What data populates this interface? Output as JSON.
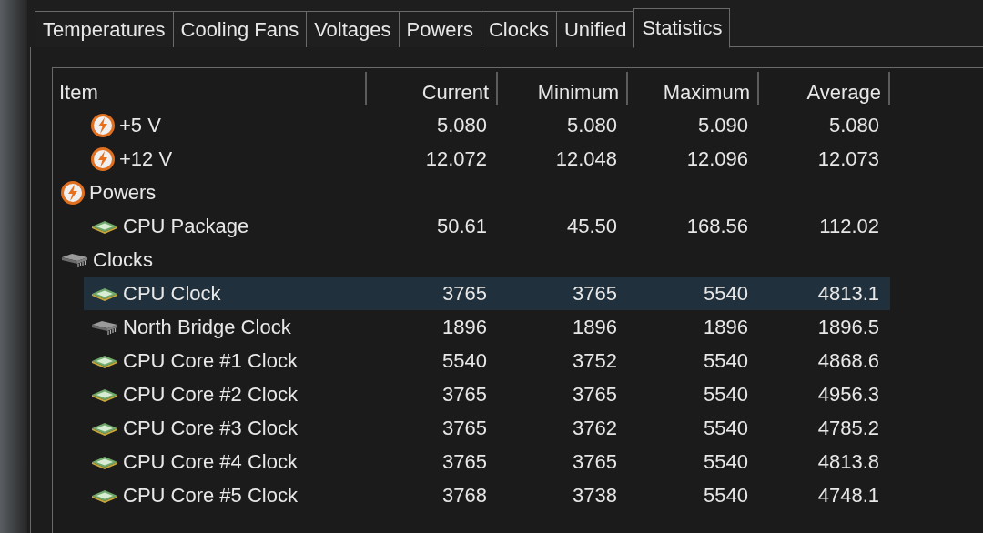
{
  "tabs": [
    {
      "label": "Temperatures",
      "selected": false
    },
    {
      "label": "Cooling Fans",
      "selected": false
    },
    {
      "label": "Voltages",
      "selected": false
    },
    {
      "label": "Powers",
      "selected": false
    },
    {
      "label": "Clocks",
      "selected": false
    },
    {
      "label": "Unified",
      "selected": false
    },
    {
      "label": "Statistics",
      "selected": true
    }
  ],
  "table": {
    "columns": [
      "Item",
      "Current",
      "Minimum",
      "Maximum",
      "Average"
    ],
    "rows": [
      {
        "children": [
          {
            "kind": "bolt",
            "label": "+5 V",
            "values": [
              "5.080",
              "5.080",
              "5.090",
              "5.080"
            ],
            "selected": false
          },
          {
            "kind": "bolt",
            "label": "+12 V",
            "values": [
              "12.072",
              "12.048",
              "12.096",
              "12.073"
            ],
            "selected": false
          }
        ]
      },
      {
        "kind": "bolt",
        "label": "Powers",
        "selected": false,
        "children": [
          {
            "kind": "chip",
            "label": "CPU Package",
            "values": [
              "50.61",
              "45.50",
              "168.56",
              "112.02"
            ],
            "selected": false
          }
        ]
      },
      {
        "kind": "module",
        "label": "Clocks",
        "selected": false,
        "children": [
          {
            "kind": "chip",
            "label": "CPU Clock",
            "values": [
              "3765",
              "3765",
              "5540",
              "4813.1"
            ],
            "selected": true
          },
          {
            "kind": "module",
            "label": "North Bridge Clock",
            "values": [
              "1896",
              "1896",
              "1896",
              "1896.5"
            ],
            "selected": false
          },
          {
            "kind": "chip",
            "label": "CPU Core #1 Clock",
            "values": [
              "5540",
              "3752",
              "5540",
              "4868.6"
            ],
            "selected": false
          },
          {
            "kind": "chip",
            "label": "CPU Core #2 Clock",
            "values": [
              "3765",
              "3765",
              "5540",
              "4956.3"
            ],
            "selected": false
          },
          {
            "kind": "chip",
            "label": "CPU Core #3 Clock",
            "values": [
              "3765",
              "3762",
              "5540",
              "4785.2"
            ],
            "selected": false
          },
          {
            "kind": "chip",
            "label": "CPU Core #4 Clock",
            "values": [
              "3765",
              "3765",
              "5540",
              "4813.8"
            ],
            "selected": false
          },
          {
            "kind": "chip",
            "label": "CPU Core #5 Clock",
            "values": [
              "3768",
              "3738",
              "5540",
              "4748.1"
            ],
            "selected": false
          }
        ]
      }
    ]
  }
}
